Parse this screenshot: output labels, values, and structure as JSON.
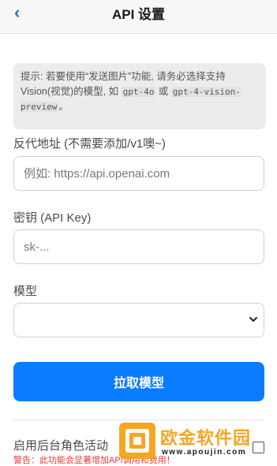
{
  "header": {
    "back_glyph": "‹",
    "title": "API 设置"
  },
  "tip": {
    "prefix": "提示: 若要使用“发送图片”功能, 请务必选择支持Vision(视觉)的模型, 如 ",
    "model_a": "gpt-4o",
    "or_text": " 或 ",
    "model_b": "gpt-4-vision-preview",
    "suffix": "。"
  },
  "proxy": {
    "label": "反代地址 (不需要添加/v1噢~)",
    "placeholder": "例如: https://api.openai.com",
    "value": ""
  },
  "api_key": {
    "label": "密钥 (API Key)",
    "placeholder": "sk-...",
    "value": ""
  },
  "model": {
    "label": "模型",
    "selected": ""
  },
  "fetch_models_button": "拉取模型",
  "background_role": {
    "label": "启用后台角色活动",
    "warning": "警告：此功能会显著增加API调用和费用！",
    "enabled": false
  },
  "watermark": {
    "title": "欧金软件园",
    "url": "www.apoujin.com",
    "color": "#f5a623"
  },
  "colors": {
    "accent": "#0a7cff",
    "back": "#1a73e8",
    "warning": "#e03b3b"
  }
}
